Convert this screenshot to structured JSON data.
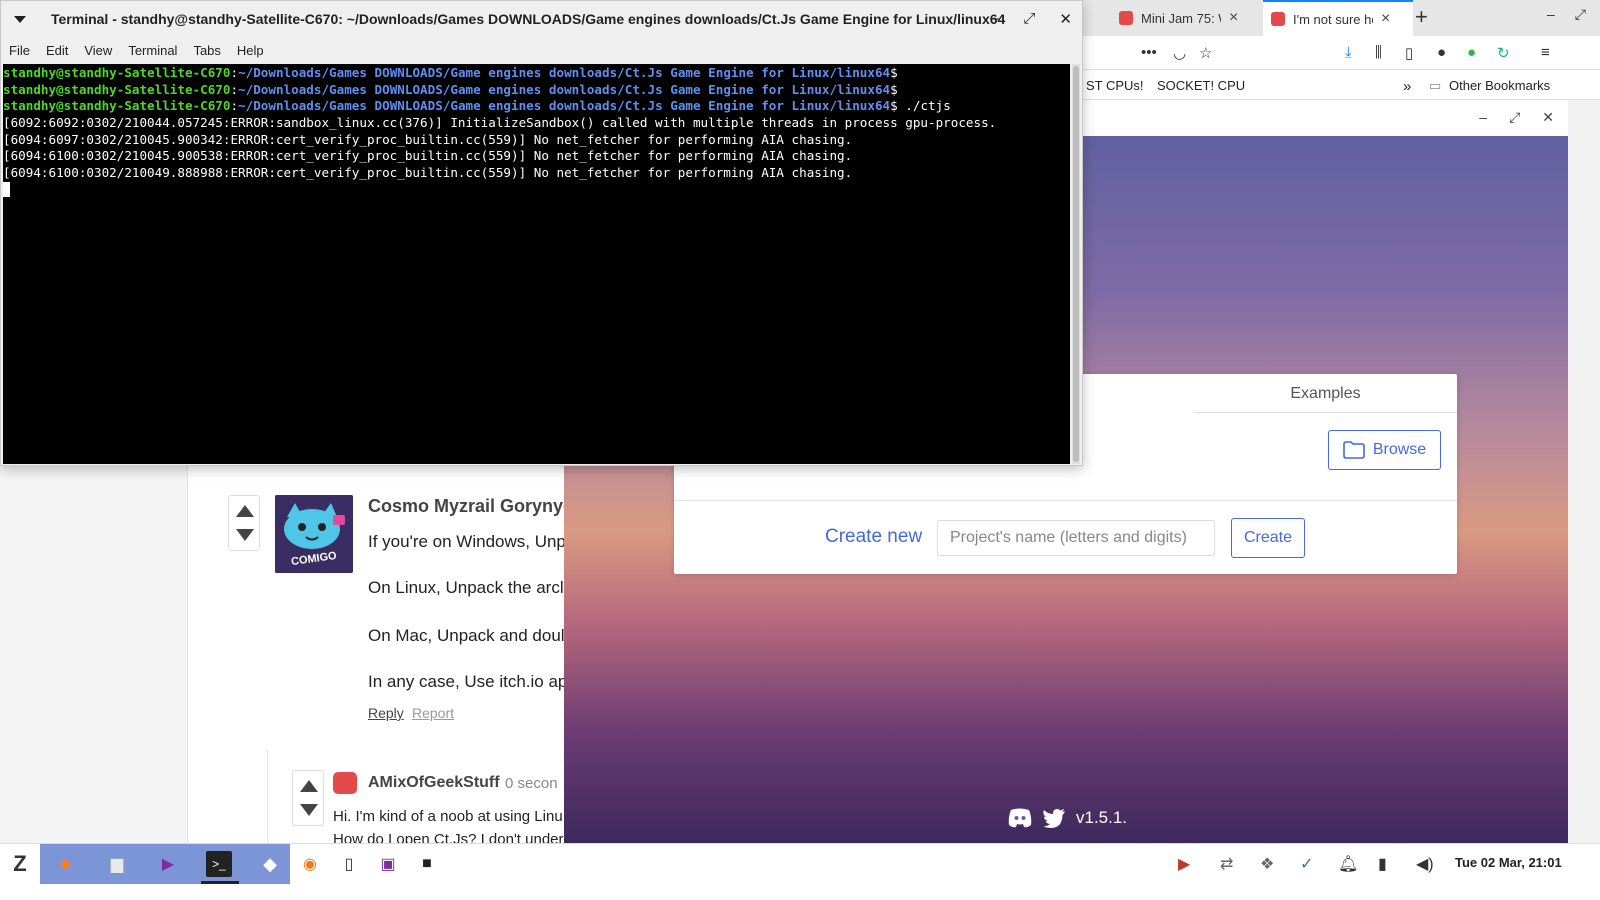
{
  "terminal": {
    "title": "Terminal - standhy@standhy-Satellite-C670: ~/Downloads/Games DOWNLOADS/Game engines downloads/Ct.Js Game Engine for Linux/linux64",
    "menu": [
      "File",
      "Edit",
      "View",
      "Terminal",
      "Tabs",
      "Help"
    ],
    "prompt_user": "standhy@standhy-Satellite-C670",
    "prompt_path": "~/Downloads/Games DOWNLOADS/Game engines downloads/Ct.Js Game Engine for Linux/linux64",
    "command": "./ctjs",
    "output": [
      "[6092:6092:0302/210044.057245:ERROR:sandbox_linux.cc(376)] InitializeSandbox() called with multiple threads in process gpu-process.",
      "[6094:6097:0302/210045.900342:ERROR:cert_verify_proc_builtin.cc(559)] No net_fetcher for performing AIA chasing.",
      "[6094:6100:0302/210045.900538:ERROR:cert_verify_proc_builtin.cc(559)] No net_fetcher for performing AIA chasing.",
      "[6094:6100:0302/210049.888988:ERROR:cert_verify_proc_builtin.cc(559)] No net_fetcher for performing AIA chasing."
    ]
  },
  "firefox": {
    "tabs": [
      {
        "title": "Mini Jam 75: W"
      },
      {
        "title": "I'm not sure ho"
      }
    ],
    "bookmarks": [
      "ST CPUs!",
      "SOCKET! CPU",
      "Other Bookmarks"
    ]
  },
  "comments": {
    "first": {
      "author": "Cosmo Myzrail Gorynych",
      "avatar_text": "COMIGO",
      "lines": [
        "If you're on Windows, Unp",
        "On Linux, Unpack the arcl",
        "On Mac, Unpack and doul",
        "In any case, Use itch.io app"
      ],
      "reply": "Reply",
      "report": "Report"
    },
    "second": {
      "author": "AMixOfGeekStuff",
      "time": "0 secon",
      "lines": [
        "Hi. I'm kind of a noob at using Linu",
        "How do I open Ct.Js? I don't under"
      ]
    }
  },
  "ctjs": {
    "examples_tab": "Examples",
    "browse_label": "Browse",
    "create_new_label": "Create new",
    "project_placeholder": "Project's name (letters and digits)",
    "create_label": "Create",
    "version": "v1.5.1."
  },
  "taskbar": {
    "clock": "Tue 02 Mar, 21:01"
  },
  "colors": {
    "accent": "#446adb",
    "prompt_user": "#4fd629",
    "prompt_path": "#5f8ff0",
    "taskbar_pinned": "#7b95d6"
  }
}
